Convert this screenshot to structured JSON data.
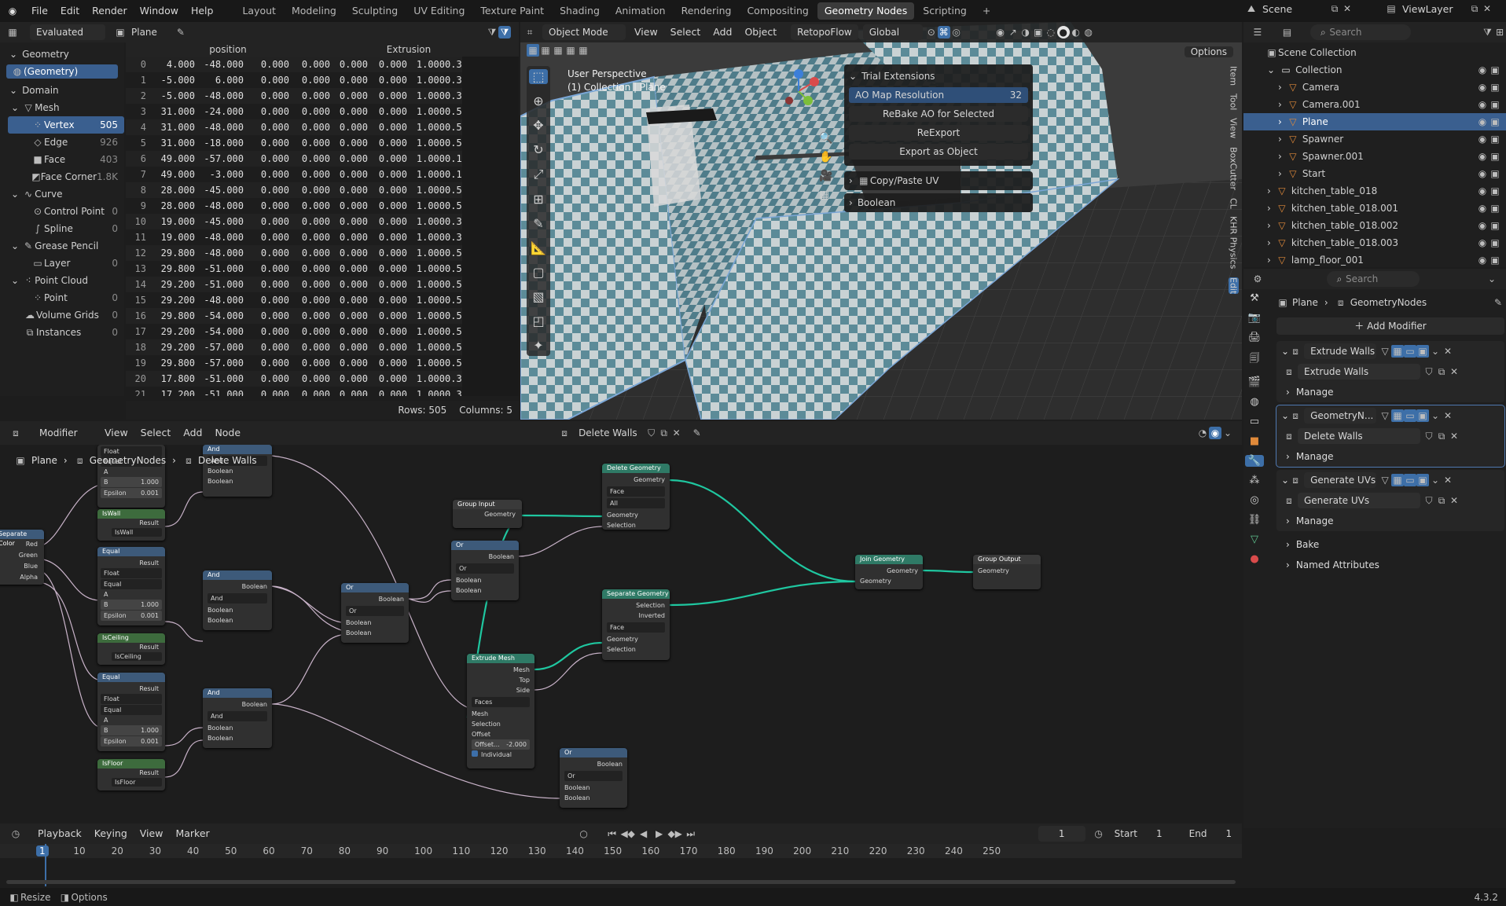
{
  "topbar": {
    "menus": [
      "File",
      "Edit",
      "Render",
      "Window",
      "Help"
    ],
    "workspaces": [
      "Layout",
      "Modeling",
      "Sculpting",
      "UV Editing",
      "Texture Paint",
      "Shading",
      "Animation",
      "Rendering",
      "Compositing",
      "Geometry Nodes",
      "Scripting"
    ],
    "active_workspace": "Geometry Nodes",
    "scene": "Scene",
    "view_layer": "ViewLayer"
  },
  "spreadsheet": {
    "mode": "Evaluated",
    "object": "Plane",
    "tree": {
      "geometry_label": "Geometry",
      "geometry_item": "(Geometry)",
      "domain_label": "Domain",
      "mesh": "Mesh",
      "mesh_items": [
        {
          "label": "Vertex",
          "count": "505"
        },
        {
          "label": "Edge",
          "count": "926"
        },
        {
          "label": "Face",
          "count": "403"
        },
        {
          "label": "Face Corner",
          "count": "1.8K"
        }
      ],
      "curve": "Curve",
      "curve_items": [
        {
          "label": "Control Point",
          "count": "0"
        },
        {
          "label": "Spline",
          "count": "0"
        }
      ],
      "grease_pencil": "Grease Pencil",
      "gp_items": [
        {
          "label": "Layer",
          "count": "0"
        }
      ],
      "point_cloud": "Point Cloud",
      "pc_items": [
        {
          "label": "Point",
          "count": "0"
        }
      ],
      "volume_grids": {
        "label": "Volume Grids",
        "count": "0"
      },
      "instances": {
        "label": "Instances",
        "count": "0"
      }
    },
    "columns": [
      "position",
      "Extrusion"
    ],
    "rows": [
      [
        "0",
        "4.000",
        "-48.000",
        "0.000",
        "0.000",
        "0.000",
        "0.000",
        "1.000",
        "0.3"
      ],
      [
        "1",
        "-5.000",
        "6.000",
        "0.000",
        "0.000",
        "0.000",
        "0.000",
        "1.000",
        "0.3"
      ],
      [
        "2",
        "-5.000",
        "-48.000",
        "0.000",
        "0.000",
        "0.000",
        "0.000",
        "1.000",
        "0.3"
      ],
      [
        "3",
        "31.000",
        "-24.000",
        "0.000",
        "0.000",
        "0.000",
        "0.000",
        "1.000",
        "0.5"
      ],
      [
        "4",
        "31.000",
        "-48.000",
        "0.000",
        "0.000",
        "0.000",
        "0.000",
        "1.000",
        "0.5"
      ],
      [
        "5",
        "31.000",
        "-18.000",
        "0.000",
        "0.000",
        "0.000",
        "0.000",
        "1.000",
        "0.5"
      ],
      [
        "6",
        "49.000",
        "-57.000",
        "0.000",
        "0.000",
        "0.000",
        "0.000",
        "1.000",
        "0.1"
      ],
      [
        "7",
        "49.000",
        "-3.000",
        "0.000",
        "0.000",
        "0.000",
        "0.000",
        "1.000",
        "0.1"
      ],
      [
        "8",
        "28.000",
        "-45.000",
        "0.000",
        "0.000",
        "0.000",
        "0.000",
        "1.000",
        "0.5"
      ],
      [
        "9",
        "28.000",
        "-48.000",
        "0.000",
        "0.000",
        "0.000",
        "0.000",
        "1.000",
        "0.5"
      ],
      [
        "10",
        "19.000",
        "-45.000",
        "0.000",
        "0.000",
        "0.000",
        "0.000",
        "1.000",
        "0.3"
      ],
      [
        "11",
        "19.000",
        "-48.000",
        "0.000",
        "0.000",
        "0.000",
        "0.000",
        "1.000",
        "0.3"
      ],
      [
        "12",
        "29.800",
        "-48.000",
        "0.000",
        "0.000",
        "0.000",
        "0.000",
        "1.000",
        "0.5"
      ],
      [
        "13",
        "29.800",
        "-51.000",
        "0.000",
        "0.000",
        "0.000",
        "0.000",
        "1.000",
        "0.5"
      ],
      [
        "14",
        "29.200",
        "-51.000",
        "0.000",
        "0.000",
        "0.000",
        "0.000",
        "1.000",
        "0.5"
      ],
      [
        "15",
        "29.200",
        "-48.000",
        "0.000",
        "0.000",
        "0.000",
        "0.000",
        "1.000",
        "0.5"
      ],
      [
        "16",
        "29.800",
        "-54.000",
        "0.000",
        "0.000",
        "0.000",
        "0.000",
        "1.000",
        "0.5"
      ],
      [
        "17",
        "29.200",
        "-54.000",
        "0.000",
        "0.000",
        "0.000",
        "0.000",
        "1.000",
        "0.5"
      ],
      [
        "18",
        "29.200",
        "-57.000",
        "0.000",
        "0.000",
        "0.000",
        "0.000",
        "1.000",
        "0.5"
      ],
      [
        "19",
        "29.800",
        "-57.000",
        "0.000",
        "0.000",
        "0.000",
        "0.000",
        "1.000",
        "0.5"
      ],
      [
        "20",
        "17.800",
        "-51.000",
        "0.000",
        "0.000",
        "0.000",
        "0.000",
        "1.000",
        "0.3"
      ],
      [
        "21",
        "17.200",
        "-51.000",
        "0.000",
        "0.000",
        "0.000",
        "0.000",
        "1.000",
        "0.3"
      ]
    ],
    "footer": {
      "rows": "Rows: 505",
      "columns": "Columns: 5"
    }
  },
  "viewport": {
    "mode": "Object Mode",
    "menus": [
      "View",
      "Select",
      "Add",
      "Object"
    ],
    "retopoflow": "RetopoFlow",
    "orientation": "Global",
    "options": "Options",
    "overlay_title": "User Perspective",
    "overlay_sub": "(1) Collection | Plane",
    "side_tabs": [
      "Item",
      "Tool",
      "View",
      "BoxCutter",
      "CL",
      "KHR Physics",
      "Edit"
    ],
    "trial": {
      "title": "Trial Extensions",
      "ao_label": "AO Map Resolution",
      "ao_value": "32",
      "rebake": "ReBake AO for Selected",
      "reexport": "ReExport",
      "export": "Export as Object",
      "copy_paste": "Copy/Paste UV",
      "boolean": "Boolean"
    }
  },
  "outliner": {
    "search_placeholder": "Search",
    "scene_collection": "Scene Collection",
    "items": [
      {
        "label": "Collection",
        "indent": 1,
        "sel": false
      },
      {
        "label": "Camera",
        "indent": 2,
        "sel": false
      },
      {
        "label": "Camera.001",
        "indent": 2,
        "sel": false
      },
      {
        "label": "Plane",
        "indent": 2,
        "sel": true
      },
      {
        "label": "Spawner",
        "indent": 2,
        "sel": false
      },
      {
        "label": "Spawner.001",
        "indent": 2,
        "sel": false
      },
      {
        "label": "Start",
        "indent": 2,
        "sel": false
      },
      {
        "label": "kitchen_table_018",
        "indent": 1,
        "sel": false
      },
      {
        "label": "kitchen_table_018.001",
        "indent": 1,
        "sel": false
      },
      {
        "label": "kitchen_table_018.002",
        "indent": 1,
        "sel": false
      },
      {
        "label": "kitchen_table_018.003",
        "indent": 1,
        "sel": false
      },
      {
        "label": "lamp_floor_001",
        "indent": 1,
        "sel": false
      },
      {
        "label": "lamp_floor_001.001",
        "indent": 1,
        "sel": false
      }
    ]
  },
  "properties": {
    "search_placeholder": "Search",
    "breadcrumb_obj": "Plane",
    "breadcrumb_mod": "GeometryNodes",
    "add_modifier": "Add Modifier",
    "modifiers": [
      {
        "name": "Extrude Walls",
        "group": "Extrude Walls",
        "manage": "Manage"
      },
      {
        "name": "GeometryN...",
        "group": "Delete Walls",
        "manage": "Manage"
      },
      {
        "name": "Generate UVs",
        "group": "Generate UVs",
        "manage": "Manage"
      }
    ],
    "bake": "Bake",
    "named_attributes": "Named Attributes"
  },
  "node_editor": {
    "menus": [
      "Modifier",
      "View",
      "Select",
      "Add",
      "Node"
    ],
    "node_tree": "Delete Walls",
    "breadcrumb": [
      "Plane",
      "GeometryNodes",
      "Delete Walls"
    ],
    "nodes": {
      "separate_color": {
        "title": "Separate Color",
        "outs": [
          "Red",
          "Green",
          "Blue",
          "Alpha"
        ]
      },
      "equal1": {
        "title": "Equal",
        "sel1": "Float",
        "sel2": "Equal",
        "a": "A",
        "b": "B",
        "bval": "1.000",
        "eps": "Epsilon",
        "epsval": "0.001",
        "result": "Result"
      },
      "iswall": {
        "title": "IsWall",
        "result": "Result",
        "attr": "IsWall"
      },
      "iswall_and": {
        "title": "And",
        "sel": "And",
        "in1": "Boolean",
        "in2": "Boolean",
        "out": "Boolean"
      },
      "equal2": {
        "title": "Equal",
        "sel1": "Float",
        "sel2": "Equal",
        "a": "A",
        "b": "B",
        "bval": "1.000",
        "eps": "Epsilon",
        "epsval": "0.001",
        "result": "Result"
      },
      "isceiling": {
        "title": "IsCeiling",
        "result": "Result",
        "attr": "IsCeiling"
      },
      "and2": {
        "title": "And",
        "sel": "And",
        "in1": "Boolean",
        "in2": "Boolean",
        "out": "Boolean"
      },
      "equal3": {
        "title": "Equal",
        "sel1": "Float",
        "sel2": "Equal",
        "a": "A",
        "b": "B",
        "bval": "1.000",
        "eps": "Epsilon",
        "epsval": "0.001",
        "result": "Result"
      },
      "isfloor": {
        "title": "IsFloor",
        "result": "Result",
        "attr": "IsFloor"
      },
      "and3": {
        "title": "And",
        "sel": "And",
        "in1": "Boolean",
        "in2": "Boolean",
        "out": "Boolean"
      },
      "or1": {
        "title": "Or",
        "sel": "Or",
        "in1": "Boolean",
        "in2": "Boolean",
        "out": "Boolean"
      },
      "group_input": {
        "title": "Group Input",
        "out": "Geometry"
      },
      "or2": {
        "title": "Or",
        "sel": "Or",
        "in1": "Boolean",
        "in2": "Boolean",
        "out": "Boolean"
      },
      "delete_geo": {
        "title": "Delete Geometry",
        "out": "Geometry",
        "sel1": "Face",
        "sel2": "All",
        "in1": "Geometry",
        "in2": "Selection"
      },
      "separate_geo": {
        "title": "Separate Geometry",
        "out1": "Selection",
        "out2": "Inverted",
        "sel": "Face",
        "in1": "Geometry",
        "in2": "Selection"
      },
      "extrude": {
        "title": "Extrude Mesh",
        "out1": "Mesh",
        "out2": "Top",
        "out3": "Side",
        "sel": "Faces",
        "in1": "Mesh",
        "in2": "Selection",
        "in3": "Offset",
        "in4": "Offset...",
        "in4val": "-2.000",
        "in5": "Individual"
      },
      "or3": {
        "title": "Or",
        "sel": "Or",
        "in1": "Boolean",
        "in2": "Boolean",
        "out": "Boolean"
      },
      "join": {
        "title": "Join Geometry",
        "out": "Geometry",
        "in": "Geometry"
      },
      "group_output": {
        "title": "Group Output",
        "in": "Geometry"
      }
    }
  },
  "timeline": {
    "menus": [
      "Playback",
      "Keying",
      "View",
      "Marker"
    ],
    "current": "1",
    "start_label": "Start",
    "start": "1",
    "end_label": "End",
    "end": "1",
    "ticks": [
      "1",
      "10",
      "20",
      "30",
      "40",
      "50",
      "60",
      "70",
      "80",
      "90",
      "100",
      "110",
      "120",
      "130",
      "140",
      "150",
      "160",
      "170",
      "180",
      "190",
      "200",
      "210",
      "220",
      "230",
      "240",
      "250"
    ]
  },
  "statusbar": {
    "resize": "Resize",
    "options": "Options",
    "version": "4.3.2"
  }
}
